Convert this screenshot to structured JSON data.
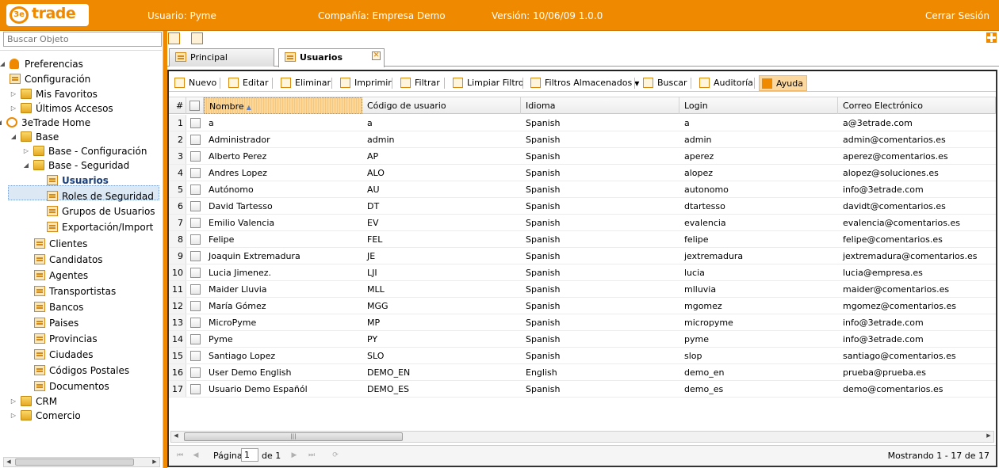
{
  "header": {
    "logo_text": "trade",
    "logo_mark": "3e",
    "user": "Usuario: Pyme",
    "company": "Compañía: Empresa Demo",
    "version": "Versión: 10/06/09 1.0.0",
    "logout": "Cerrar Sesión",
    "brand_color": "#ef8a00"
  },
  "sidebar": {
    "search_placeholder": "Buscar Objeto",
    "tree": [
      {
        "label": "Preferencias",
        "icon": "user-icon",
        "expanded": true
      },
      {
        "label": "Configuración",
        "icon": "form-icon"
      },
      {
        "label": "Mis Favoritos",
        "icon": "folder-icon",
        "expanded": false
      },
      {
        "label": "Últimos Accesos",
        "icon": "folder-icon",
        "expanded": false
      },
      {
        "label": "3eTrade Home",
        "icon": "home-icon",
        "expanded": true
      },
      {
        "label": "Base",
        "icon": "folder-icon",
        "expanded": true
      },
      {
        "label": "Base - Configuración",
        "icon": "folder-icon",
        "expanded": false
      },
      {
        "label": "Base - Seguridad",
        "icon": "folder-icon",
        "expanded": true
      },
      {
        "label": "Usuarios",
        "icon": "form-icon",
        "selected": true
      },
      {
        "label": "Roles de Seguridad",
        "icon": "form-icon"
      },
      {
        "label": "Grupos de Usuarios",
        "icon": "form-icon"
      },
      {
        "label": "Exportación/Import",
        "icon": "form-icon"
      },
      {
        "label": "Clientes",
        "icon": "form-icon"
      },
      {
        "label": "Candidatos",
        "icon": "form-icon"
      },
      {
        "label": "Agentes",
        "icon": "form-icon"
      },
      {
        "label": "Transportistas",
        "icon": "form-icon"
      },
      {
        "label": "Bancos",
        "icon": "form-icon"
      },
      {
        "label": "Paises",
        "icon": "form-icon"
      },
      {
        "label": "Provincias",
        "icon": "form-icon"
      },
      {
        "label": "Ciudades",
        "icon": "form-icon"
      },
      {
        "label": "Códigos Postales",
        "icon": "form-icon"
      },
      {
        "label": "Documentos",
        "icon": "form-icon"
      },
      {
        "label": "CRM",
        "icon": "folder-icon",
        "expanded": false
      },
      {
        "label": "Comercio",
        "icon": "folder-icon",
        "expanded": false
      }
    ]
  },
  "tabs": [
    {
      "label": "Principal",
      "active": false
    },
    {
      "label": "Usuarios",
      "active": true
    }
  ],
  "toolbar": {
    "nuevo": "Nuevo",
    "editar": "Editar",
    "eliminar": "Eliminar",
    "imprimir": "Imprimir",
    "filtrar": "Filtrar",
    "limpiar": "Limpiar Filtro",
    "filtros": "Filtros Almacenados",
    "buscar": "Buscar",
    "auditoria": "Auditoría",
    "ayuda": "Ayuda"
  },
  "grid": {
    "columns": [
      "#",
      "Nombre",
      "Código de usuario",
      "Idioma",
      "Login",
      "Correo Electrónico"
    ],
    "rows": [
      [
        "1",
        "a",
        "a",
        "Spanish",
        "a",
        "a@3etrade.com"
      ],
      [
        "2",
        "Administrador",
        "admin",
        "Spanish",
        "admin",
        "admin@comentarios.es"
      ],
      [
        "3",
        "Alberto Perez",
        "AP",
        "Spanish",
        "aperez",
        "aperez@comentarios.es"
      ],
      [
        "4",
        "Andres Lopez",
        "ALO",
        "Spanish",
        "alopez",
        "alopez@soluciones.es"
      ],
      [
        "5",
        "Autónomo",
        "AU",
        "Spanish",
        "autonomo",
        "info@3etrade.com"
      ],
      [
        "6",
        "David Tartesso",
        "DT",
        "Spanish",
        "dtartesso",
        "davidt@comentarios.es"
      ],
      [
        "7",
        "Emilio Valencia",
        "EV",
        "Spanish",
        "evalencia",
        "evalencia@comentarios.es"
      ],
      [
        "8",
        "Felipe",
        "FEL",
        "Spanish",
        "felipe",
        "felipe@comentarios.es"
      ],
      [
        "9",
        "Joaquin Extremadura",
        "JE",
        "Spanish",
        "jextremadura",
        "jextremadura@comentarios.es"
      ],
      [
        "10",
        "Lucia Jimenez.",
        "LJI",
        "Spanish",
        "lucia",
        "lucia@empresa.es"
      ],
      [
        "11",
        "Maider Lluvia",
        "MLL",
        "Spanish",
        "mlluvia",
        "maider@comentarios.es"
      ],
      [
        "12",
        "María Gómez",
        "MGG",
        "Spanish",
        "mgomez",
        "mgomez@comentarios.es"
      ],
      [
        "13",
        "MicroPyme",
        "MP",
        "Spanish",
        "micropyme",
        "info@3etrade.com"
      ],
      [
        "14",
        "Pyme",
        "PY",
        "Spanish",
        "pyme",
        "info@3etrade.com"
      ],
      [
        "15",
        "Santiago Lopez",
        "SLO",
        "Spanish",
        "slop",
        "santiago@comentarios.es"
      ],
      [
        "16",
        "User Demo English",
        "DEMO_EN",
        "English",
        "demo_en",
        "prueba@prueba.es"
      ],
      [
        "17",
        "Usuario Demo Españól",
        "DEMO_ES",
        "Spanish",
        "demo_es",
        "demo@comentarios.es"
      ]
    ]
  },
  "pager": {
    "page_label": "Página",
    "page_value": "1",
    "of_label": "de 1",
    "status": "Mostrando 1 - 17 de 17"
  }
}
